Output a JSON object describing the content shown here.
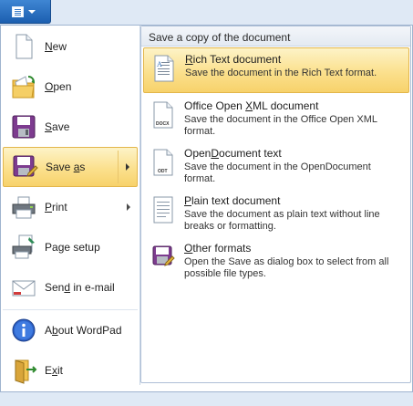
{
  "menu": {
    "items": [
      {
        "id": "new",
        "label": "New",
        "ul": 0
      },
      {
        "id": "open",
        "label": "Open",
        "ul": 0
      },
      {
        "id": "save",
        "label": "Save",
        "ul": 0
      },
      {
        "id": "save_as",
        "label": "Save as",
        "ul": 5,
        "selected": true,
        "submenu": true
      },
      {
        "id": "print",
        "label": "Print",
        "ul": 0,
        "submenu": true
      },
      {
        "id": "page_setup",
        "label": "Page setup",
        "ul": 2
      },
      {
        "id": "send_email",
        "label": "Send in e-mail",
        "ul": 3
      },
      {
        "id": "about",
        "label": "About WordPad",
        "ul": 1
      },
      {
        "id": "exit",
        "label": "Exit",
        "ul": 1
      }
    ]
  },
  "panel": {
    "title": "Save a copy of the document",
    "options": [
      {
        "id": "rtf",
        "title": "Rich Text document",
        "ul": 0,
        "desc": "Save the document in the Rich Text format.",
        "selected": true,
        "icon_label": ""
      },
      {
        "id": "docx",
        "title": "Office Open XML document",
        "ul": 12,
        "desc": "Save the document in the Office Open XML format.",
        "icon_label": "DOCX"
      },
      {
        "id": "odt",
        "title": "OpenDocument text",
        "ul": 4,
        "desc": "Save the document in the OpenDocument format.",
        "icon_label": "ODT"
      },
      {
        "id": "txt",
        "title": "Plain text document",
        "ul": 0,
        "desc": "Save the document as plain text without line breaks or formatting.",
        "icon_label": ""
      },
      {
        "id": "other",
        "title": "Other formats",
        "ul": 0,
        "desc": "Open the Save as dialog box to select from all possible file types.",
        "icon_label": ""
      }
    ]
  },
  "colors": {
    "accent": "#1c5fb0",
    "highlight": "#fbe08d"
  }
}
